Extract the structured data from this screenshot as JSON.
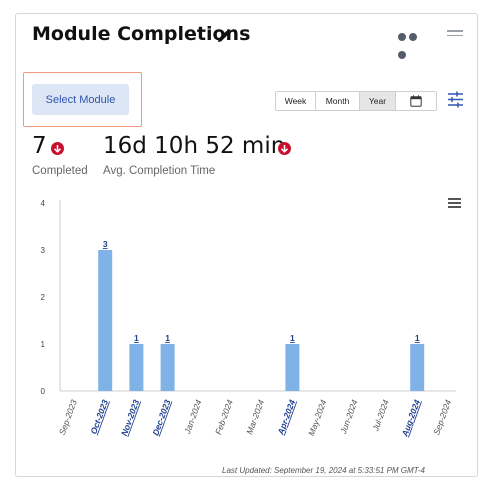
{
  "header": {
    "title": "Module Completions",
    "icons": {
      "edit": "pencil-icon",
      "more": "more-dots-icon",
      "drag": "drag-handle-icon"
    }
  },
  "controls": {
    "select_module_label": "Select Module",
    "periods": [
      "Week",
      "Month",
      "Year"
    ],
    "selected_period": "Year",
    "calendar_icon": "calendar-icon",
    "filter_icon": "filter-sliders-icon"
  },
  "stats": [
    {
      "value": "7",
      "label": "Completed",
      "trend": "down",
      "trend_color": "#c8102e"
    },
    {
      "value": "16d 10h 52 min",
      "label": "Avg. Completion Time",
      "trend": "down",
      "trend_color": "#c8102e"
    }
  ],
  "chart_data": {
    "type": "bar",
    "categories": [
      "Sep-2023",
      "Oct-2023",
      "Nov-2023",
      "Dec-2023",
      "Jan-2024",
      "Feb-2024",
      "Mar-2024",
      "Apr-2024",
      "May-2024",
      "Jun-2024",
      "Jul-2024",
      "Aug-2024",
      "Sep-2024"
    ],
    "values": [
      0,
      3,
      1,
      1,
      0,
      0,
      0,
      1,
      0,
      0,
      0,
      1,
      0
    ],
    "data_labels": [
      "",
      "3",
      "1",
      "1",
      "",
      "",
      "",
      "1",
      "",
      "",
      "",
      "1",
      ""
    ],
    "ylim": [
      0,
      4
    ],
    "yticks": [
      "0",
      "1",
      "2",
      "3",
      "4"
    ],
    "bar_color": "#7fb3e8",
    "link_color": "#1f3f8f",
    "grid": false,
    "menu_icon": "hamburger-menu-icon"
  },
  "footer": {
    "last_updated": "Last Updated: September 19, 2024 at 5:33:51 PM GMT-4"
  }
}
